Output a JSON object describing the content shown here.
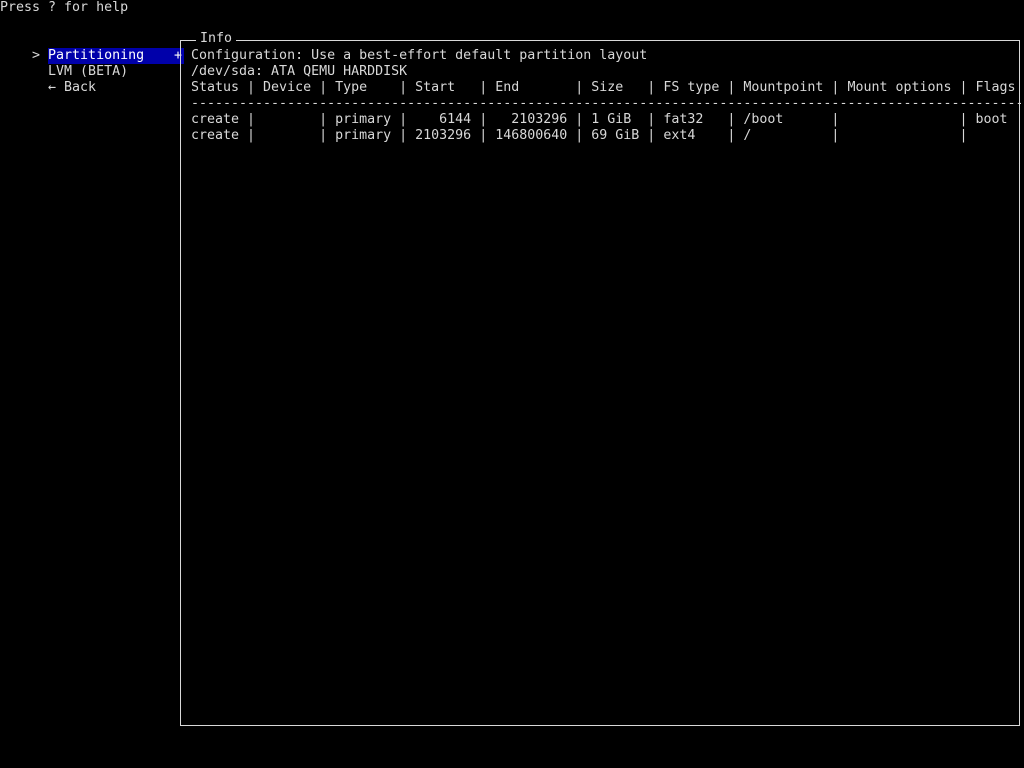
{
  "help_text": "Press ? for help",
  "menu": {
    "items": [
      {
        "pointer": ">",
        "label": "Partitioning",
        "suffix": "+"
      },
      {
        "pointer": "",
        "label": "LVM (BETA)",
        "suffix": ""
      },
      {
        "pointer": "",
        "label": "← Back",
        "suffix": ""
      }
    ]
  },
  "info": {
    "title": "Info",
    "configuration": "Configuration: Use a best-effort default partition layout",
    "device": "/dev/sda: ATA QEMU HARDDISK",
    "header": "Status | Device | Type    | Start   | End       | Size   | FS type | Mountpoint | Mount options | Flags",
    "separator": "----------------------------------------------------------------------------------------------------------",
    "rows": [
      "create |        | primary |    6144 |   2103296 | 1 GiB  | fat32   | /boot      |               | boot",
      "create |        | primary | 2103296 | 146800640 | 69 GiB | ext4    | /          |               |"
    ]
  }
}
